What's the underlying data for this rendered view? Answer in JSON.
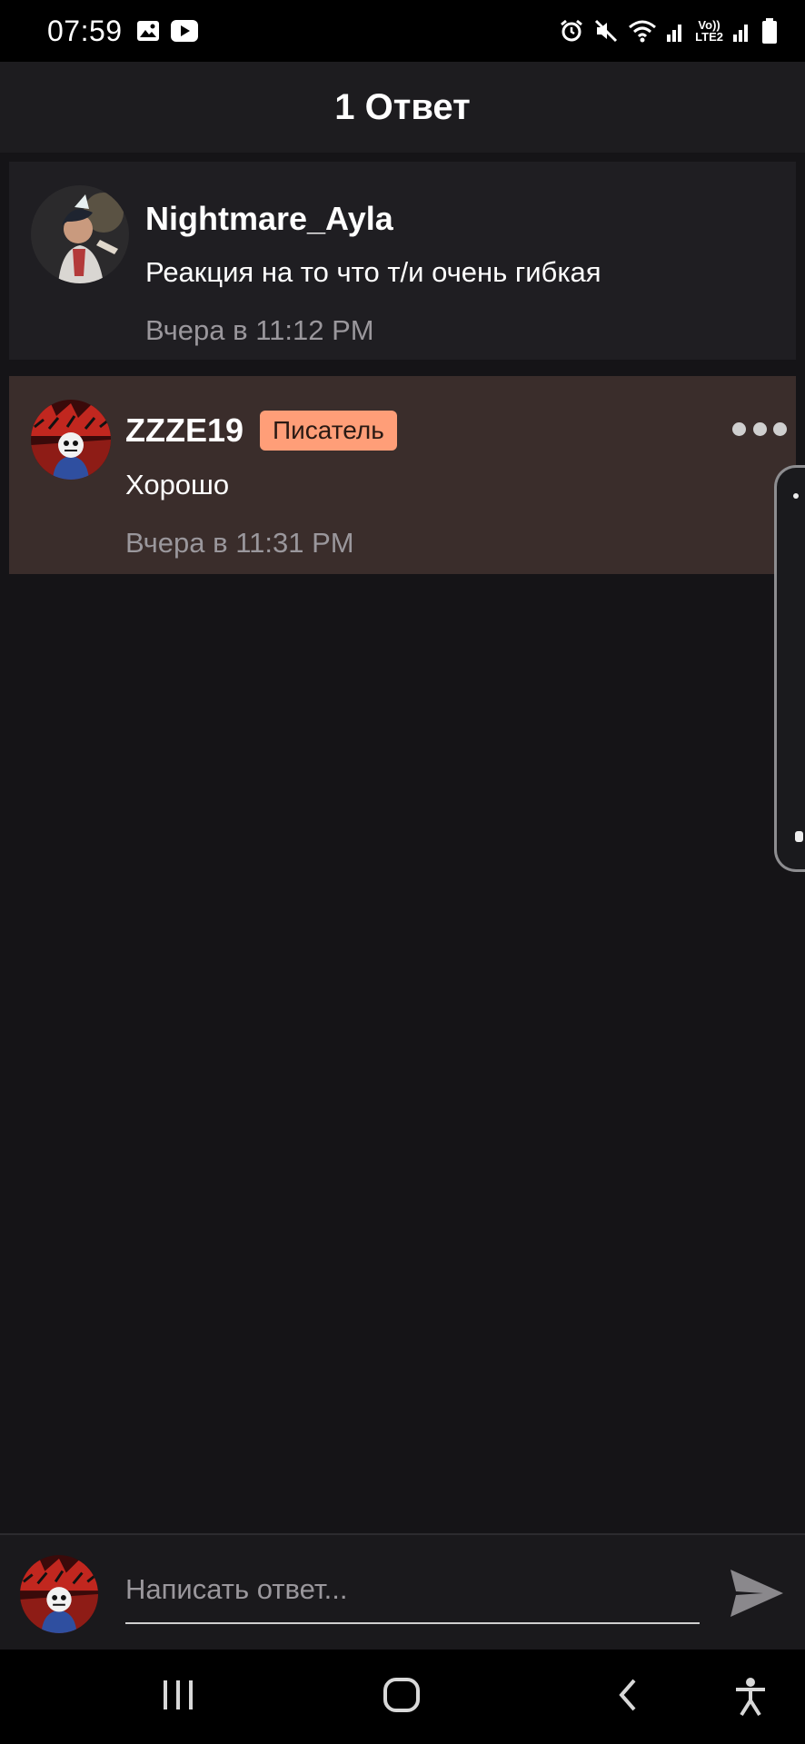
{
  "status_bar": {
    "time": "07:59",
    "network_label_top": "Vo))",
    "network_label_bottom": "LTE2",
    "icons": [
      "gallery-icon",
      "youtube-icon",
      "alarm-icon",
      "mute-icon",
      "wifi-icon",
      "signal-icon",
      "signal-icon-2",
      "battery-icon"
    ]
  },
  "header": {
    "title": "1 Ответ"
  },
  "parent_comment": {
    "author": "Nightmare_Ayla",
    "text": "Реакция на то что т/и очень гибкая",
    "time": "Вчера в 11:12 PM"
  },
  "reply_comment": {
    "author": "ZZZE19",
    "badge": "Писатель",
    "text": "Хорошо",
    "time": "Вчера в 11:31 PM"
  },
  "reply_bar": {
    "placeholder": "Написать ответ...",
    "value": ""
  },
  "colors": {
    "background": "#151417",
    "header": "#1d1c1f",
    "reply_highlight": "#3a2d2b",
    "badge": "#ff9e78",
    "muted_text": "#9a979c"
  }
}
